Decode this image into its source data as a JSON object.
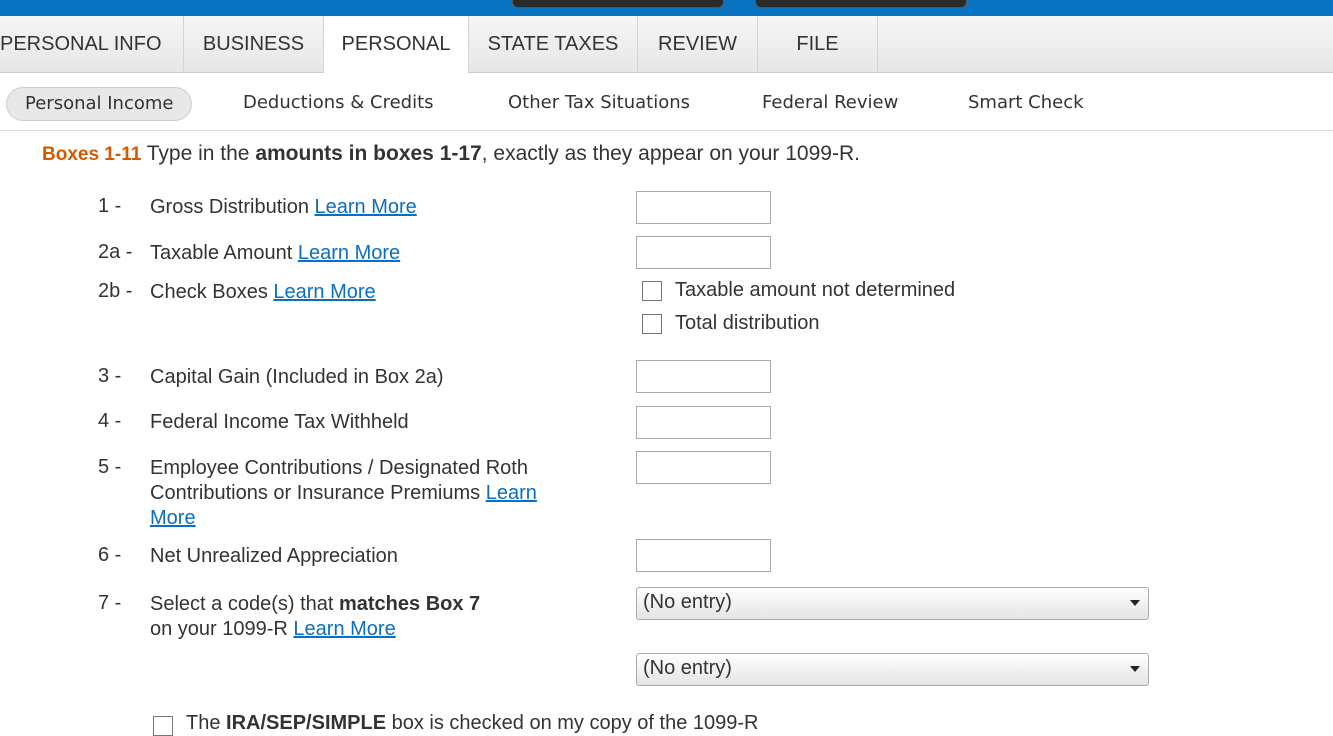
{
  "tabs": [
    "PERSONAL INFO",
    "BUSINESS",
    "PERSONAL",
    "STATE TAXES",
    "REVIEW",
    "FILE"
  ],
  "subnav": [
    "Personal Income",
    "Deductions & Credits",
    "Other Tax Situations",
    "Federal Review",
    "Smart Check"
  ],
  "heading": {
    "prefix": "Boxes 1-11",
    "t1": " Type in the ",
    "bold": "amounts in boxes 1-17",
    "t2": ", exactly as they appear on your 1099-R."
  },
  "learn_more": "Learn More",
  "rows": {
    "r1": {
      "num": "1 -",
      "label": "Gross Distribution "
    },
    "r2a": {
      "num": "2a -",
      "label": "Taxable Amount "
    },
    "r2b": {
      "num": "2b -",
      "label": "Check Boxes ",
      "cb1": "Taxable amount not determined",
      "cb2": "Total distribution"
    },
    "r3": {
      "num": "3 -",
      "label": "Capital Gain (Included in Box 2a)"
    },
    "r4": {
      "num": "4 -",
      "label": "Federal Income Tax Withheld"
    },
    "r5": {
      "num": "5 -",
      "label": "Employee Contributions / Designated Roth Contributions or Insurance Premiums ",
      "link1": "Learn",
      "link2": "More"
    },
    "r6": {
      "num": "6 -",
      "label": "Net Unrealized Appreciation"
    },
    "r7": {
      "num": "7 -",
      "t1": "Select a code(s) that ",
      "bold": "matches Box 7",
      "t2": "on your 1099-R ",
      "sel1": "(No entry)",
      "sel2": "(No entry)"
    }
  },
  "ira": {
    "t1": "The ",
    "bold": "IRA/SEP/SIMPLE",
    "t2": " box is checked on my copy of the 1099-R"
  }
}
